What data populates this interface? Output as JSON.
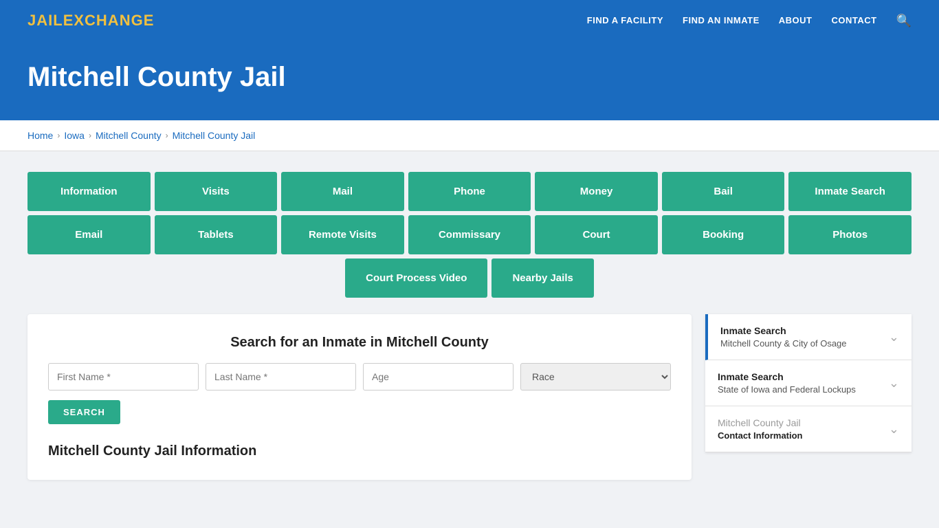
{
  "site": {
    "logo_jail": "JAIL",
    "logo_exchange": "EXCHANGE"
  },
  "navbar": {
    "links": [
      {
        "label": "FIND A FACILITY",
        "name": "find-a-facility"
      },
      {
        "label": "FIND AN INMATE",
        "name": "find-an-inmate"
      },
      {
        "label": "ABOUT",
        "name": "about"
      },
      {
        "label": "CONTACT",
        "name": "contact"
      }
    ]
  },
  "hero": {
    "title": "Mitchell County Jail"
  },
  "breadcrumb": {
    "items": [
      {
        "label": "Home",
        "name": "home"
      },
      {
        "label": "Iowa",
        "name": "iowa"
      },
      {
        "label": "Mitchell County",
        "name": "mitchell-county"
      },
      {
        "label": "Mitchell County Jail",
        "name": "mitchell-county-jail"
      }
    ]
  },
  "buttons_row1": [
    "Information",
    "Visits",
    "Mail",
    "Phone",
    "Money",
    "Bail",
    "Inmate Search"
  ],
  "buttons_row2": [
    "Email",
    "Tablets",
    "Remote Visits",
    "Commissary",
    "Court",
    "Booking",
    "Photos"
  ],
  "buttons_row3": [
    "Court Process Video",
    "Nearby Jails"
  ],
  "search": {
    "title": "Search for an Inmate in Mitchell County",
    "first_name_placeholder": "First Name *",
    "last_name_placeholder": "Last Name *",
    "age_placeholder": "Age",
    "race_placeholder": "Race",
    "button_label": "SEARCH"
  },
  "sidebar": {
    "items": [
      {
        "title": "Inmate Search",
        "subtitle": "Mitchell County & City of Osage",
        "active": true
      },
      {
        "title": "Inmate Search",
        "subtitle": "State of Iowa and Federal Lockups",
        "active": false
      },
      {
        "title": "Mitchell County Jail",
        "subtitle": "Contact Information",
        "active": false
      }
    ]
  },
  "info_section": {
    "heading": "Mitchell County Jail Information"
  }
}
